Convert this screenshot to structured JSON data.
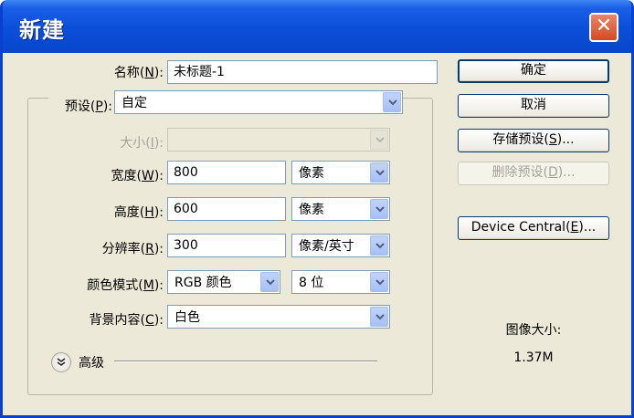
{
  "window": {
    "title": "新建",
    "close_glyph": "✕"
  },
  "form": {
    "name": {
      "label": "名称(",
      "key": "N",
      "suffix": "):",
      "value": "未标题-1"
    },
    "preset": {
      "label": "预设(",
      "key": "P",
      "suffix": "):",
      "value": "自定"
    },
    "size": {
      "label": "大小(",
      "key": "I",
      "suffix": "):",
      "value": "",
      "disabled": true
    },
    "width": {
      "label": "宽度(",
      "key": "W",
      "suffix": "):",
      "value": "800",
      "unit": "像素"
    },
    "height": {
      "label": "高度(",
      "key": "H",
      "suffix": "):",
      "value": "600",
      "unit": "像素"
    },
    "resolution": {
      "label": "分辨率(",
      "key": "R",
      "suffix": "):",
      "value": "300",
      "unit": "像素/英寸"
    },
    "color_mode": {
      "label": "颜色模式(",
      "key": "M",
      "suffix": "):",
      "value": "RGB 颜色",
      "depth": "8 位"
    },
    "background": {
      "label": "背景内容(",
      "key": "C",
      "suffix": "):",
      "value": "白色"
    },
    "advanced": {
      "label": "高级"
    }
  },
  "buttons": {
    "ok": "确定",
    "cancel": "取消",
    "save_preset": {
      "prefix": "存储预设(",
      "key": "S",
      "suffix": ")..."
    },
    "delete_preset": {
      "prefix": "删除预设(",
      "key": "D",
      "suffix": ")...",
      "disabled": true
    },
    "device_central": {
      "prefix": "Device Central(",
      "key": "E",
      "suffix": ")..."
    }
  },
  "image_size": {
    "label": "图像大小:",
    "value": "1.37M"
  },
  "colors": {
    "titlebar": "#0a4ed8",
    "dialog_bg": "#ece9d8",
    "close": "#d34a22",
    "field_border": "#7f9db9"
  }
}
